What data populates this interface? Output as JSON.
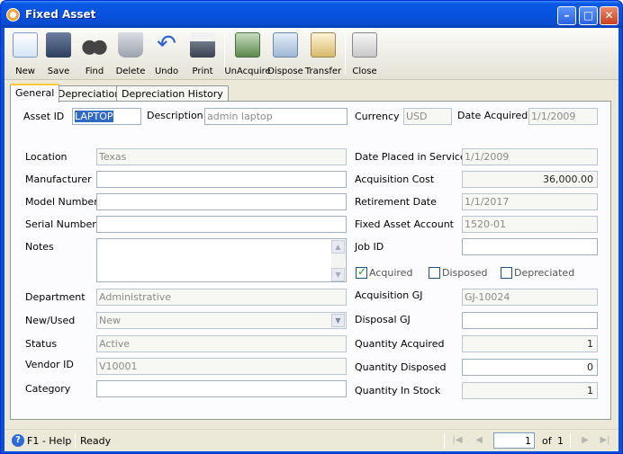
{
  "window": {
    "title": "Fixed Asset"
  },
  "toolbar": {
    "items": [
      {
        "label": "New",
        "icon": "new-record-icon"
      },
      {
        "label": "Save",
        "icon": "floppy-disk-icon"
      },
      {
        "label": "Find",
        "icon": "binoculars-icon"
      },
      {
        "label": "Delete",
        "icon": "recycle-bin-icon"
      },
      {
        "label": "Undo",
        "icon": "undo-arrow-icon"
      },
      {
        "label": "Print",
        "icon": "printer-icon"
      },
      {
        "label": "UnAcquire",
        "icon": "unacquire-icon"
      },
      {
        "label": "Dispose",
        "icon": "dispose-icon"
      },
      {
        "label": "Transfer",
        "icon": "transfer-icon"
      },
      {
        "label": "Close",
        "icon": "close-document-icon"
      }
    ]
  },
  "tabs": [
    {
      "label": "General",
      "active": true
    },
    {
      "label": "Depreciation",
      "active": false
    },
    {
      "label": "Depreciation History",
      "active": false
    }
  ],
  "header": {
    "asset_id_label": "Asset ID",
    "asset_id_value": "LAPTOP",
    "description_label": "Description",
    "description_value": "admin laptop",
    "currency_label": "Currency",
    "currency_value": "USD",
    "date_acquired_label": "Date Acquired",
    "date_acquired_value": "1/1/2009"
  },
  "left": {
    "location_label": "Location",
    "location_value": "Texas",
    "manufacturer_label": "Manufacturer",
    "manufacturer_value": "",
    "model_label": "Model Number",
    "model_value": "",
    "serial_label": "Serial Number",
    "serial_value": "",
    "notes_label": "Notes",
    "notes_value": "",
    "department_label": "Department",
    "department_value": "Administrative",
    "new_used_label": "New/Used",
    "new_used_value": "New",
    "status_label": "Status",
    "status_value": "Active",
    "vendor_label": "Vendor ID",
    "vendor_value": "V10001",
    "category_label": "Category",
    "category_value": ""
  },
  "right": {
    "date_placed_label": "Date Placed in Service",
    "date_placed_value": "1/1/2009",
    "acq_cost_label": "Acquisition Cost",
    "acq_cost_value": "36,000.00",
    "retirement_label": "Retirement Date",
    "retirement_value": "1/1/2017",
    "account_label": "Fixed Asset Account",
    "account_value": "1520-01",
    "job_label": "Job ID",
    "job_value": "",
    "acquired_label": "Acquired",
    "acquired_checked": true,
    "disposed_label": "Disposed",
    "disposed_checked": false,
    "depreciated_label": "Depreciated",
    "depreciated_checked": false,
    "acq_gj_label": "Acquisition GJ",
    "acq_gj_value": "GJ-10024",
    "disp_gj_label": "Disposal GJ",
    "disp_gj_value": "",
    "qty_acq_label": "Quantity Acquired",
    "qty_acq_value": "1",
    "qty_disp_label": "Quantity Disposed",
    "qty_disp_value": "0",
    "qty_stock_label": "Quantity In Stock",
    "qty_stock_value": "1"
  },
  "status": {
    "help": "F1 - Help",
    "state": "Ready",
    "page": "1",
    "of_label": "of",
    "total_pages": "1"
  },
  "colors": {
    "title_bar": "#0553de",
    "client_bg": "#ece9d8",
    "active_tab_accent": "#ffc83c"
  }
}
